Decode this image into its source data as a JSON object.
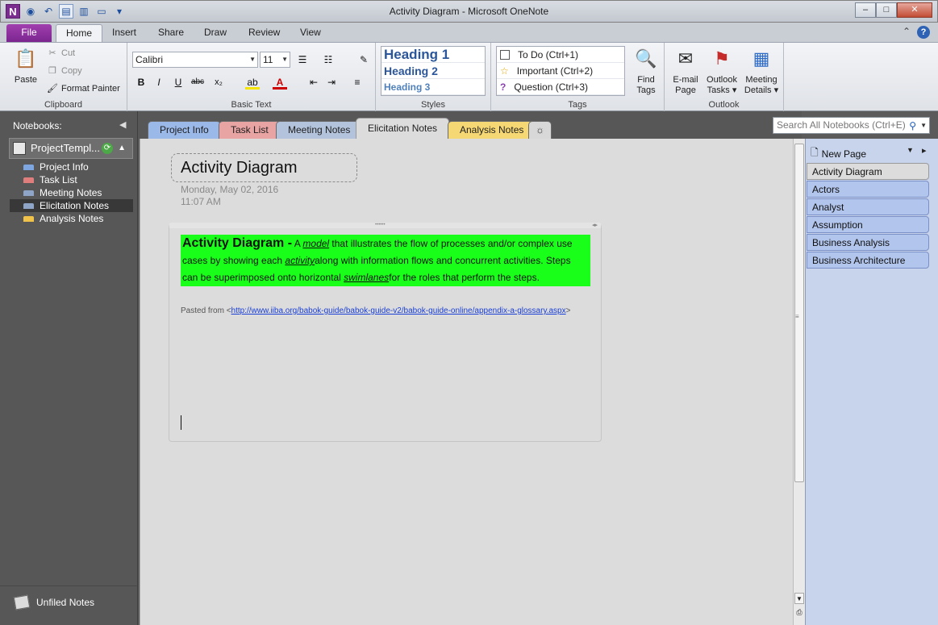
{
  "window": {
    "title": "Activity Diagram",
    "app_name": "Microsoft OneNote",
    "app_icon": "N",
    "controls": [
      "–",
      "□",
      "✕"
    ]
  },
  "ribbon": {
    "tabs": [
      "File",
      "Home",
      "Insert",
      "Share",
      "Draw",
      "Review",
      "View"
    ],
    "active_tab": "Home",
    "clipboard": {
      "paste": "Paste",
      "cut": "Cut",
      "copy": "Copy",
      "format_painter": "Format Painter",
      "label": "Clipboard"
    },
    "basic_text": {
      "font": "Calibri",
      "size": "11",
      "label": "Basic Text"
    },
    "styles": {
      "items": [
        "Heading 1",
        "Heading 2",
        "Heading 3"
      ],
      "label": "Styles"
    },
    "tags": {
      "items": [
        "To Do (Ctrl+1)",
        "Important (Ctrl+2)",
        "Question (Ctrl+3)"
      ],
      "find_tags_1": "Find",
      "find_tags_2": "Tags",
      "label": "Tags"
    },
    "outlook": {
      "email_1": "E-mail",
      "email_2": "Page",
      "tasks_1": "Outlook",
      "tasks_2": "Tasks ▾",
      "meeting_1": "Meeting",
      "meeting_2": "Details ▾",
      "label": "Outlook"
    }
  },
  "nav": {
    "header": "Notebooks:",
    "notebook": "ProjectTempl...",
    "sections": [
      {
        "label": "Project Info",
        "color": "#7ea6e0"
      },
      {
        "label": "Task List",
        "color": "#e07e7e"
      },
      {
        "label": "Meeting Notes",
        "color": "#8fa5c7"
      },
      {
        "label": "Elicitation Notes",
        "color": "#8fa5c7"
      },
      {
        "label": "Analysis Notes",
        "color": "#f0c24a"
      }
    ],
    "selected_section": "Elicitation Notes",
    "unfiled": "Unfiled Notes"
  },
  "section_tabs": {
    "items": [
      {
        "label": "Project Info",
        "color": "#9ab8e8"
      },
      {
        "label": "Task List",
        "color": "#e8a3a3"
      },
      {
        "label": "Meeting Notes",
        "color": "#b3c3dc"
      },
      {
        "label": "Elicitation Notes",
        "color": "#dcdcdc"
      },
      {
        "label": "Analysis Notes",
        "color": "#f5d773"
      }
    ],
    "new_tab": "☼"
  },
  "search": {
    "placeholder": "Search All Notebooks (Ctrl+E)"
  },
  "page": {
    "title": "Activity Diagram",
    "date": "Monday, May 02, 2016",
    "time": "11:07 AM",
    "body": {
      "term": "Activity Diagram -",
      "t1": " A ",
      "model": "model",
      "t2": " that illustrates the flow of processes and/or complex use cases by showing each ",
      "activity": "activity",
      "t3": "along with information flows and concurrent activities. Steps can be superimposed onto horizontal ",
      "swimlanes": "swimlanes",
      "t4": "for the roles that perform the steps."
    },
    "pasted_from": "Pasted from <",
    "url": "http://www.iiba.org/babok-guide/babok-guide-v2/babok-guide-online/appendix-a-glossary.aspx",
    "url_close": ">"
  },
  "page_list": {
    "new_page": "New Page",
    "items": [
      "Activity Diagram",
      "Actors",
      "Analyst",
      "Assumption",
      "Business Analysis",
      "Business Architecture"
    ],
    "selected": "Activity Diagram"
  }
}
